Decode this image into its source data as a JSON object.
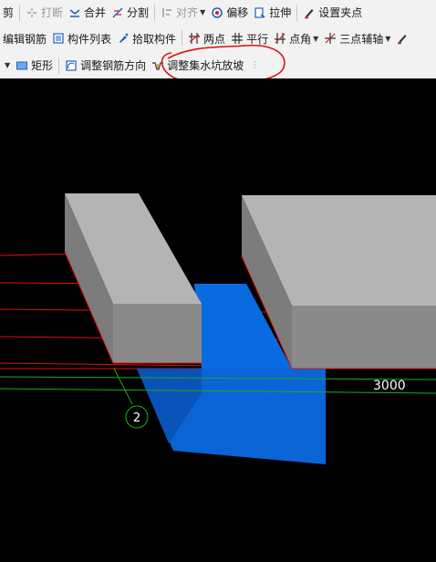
{
  "toolbar_row1": {
    "cut_label": "剪",
    "break_label": "打断",
    "merge_label": "合并",
    "split_label": "分割",
    "align_label": "对齐",
    "offset_label": "偏移",
    "stretch_label": "拉伸",
    "set_pinch_point_label": "设置夹点"
  },
  "toolbar_row2": {
    "edit_rebar_label": "编辑钢筋",
    "component_list_label": "构件列表",
    "pick_component_label": "拾取构件",
    "two_points_label": "两点",
    "parallel_label": "平行",
    "point_angle_label": "点角",
    "three_point_axis_label": "三点辅轴"
  },
  "toolbar_row3": {
    "rectangle_label": "矩形",
    "adjust_rebar_direction_label": "调整钢筋方向",
    "adjust_sump_slope_label": "调整集水坑放坡"
  },
  "viewport": {
    "dimension_label": "3000",
    "axis_marker": "2"
  },
  "colors": {
    "background": "#000000",
    "block_top": "#b4b4b4",
    "block_side": "#7c7c7c",
    "sump_blue": "#0a6be0",
    "annotation_red": "#e01010",
    "axis_green": "#1faa1f"
  }
}
